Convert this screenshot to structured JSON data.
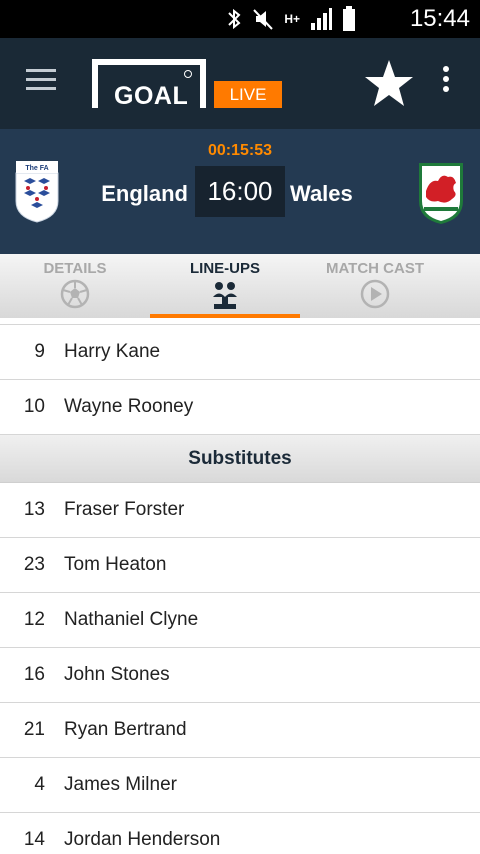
{
  "status_bar": {
    "time": "15:44",
    "network_label": "H+"
  },
  "app_bar": {
    "logo_text": "GOAL",
    "live_label": "LIVE"
  },
  "match": {
    "clock": "00:15:53",
    "home_team": "England",
    "away_team": "Wales",
    "score": "16:00",
    "home_badge_text": "The FA"
  },
  "tabs": [
    {
      "label": "DETAILS",
      "icon": "soccer-ball-icon",
      "active": false
    },
    {
      "label": "LINE-UPS",
      "icon": "lineup-icon",
      "active": true
    },
    {
      "label": "MATCH CAST",
      "icon": "play-circle-icon",
      "active": false
    }
  ],
  "starters_tail": [
    {
      "number": "9",
      "name": "Harry Kane"
    },
    {
      "number": "10",
      "name": "Wayne Rooney"
    }
  ],
  "substitutes_header": "Substitutes",
  "substitutes": [
    {
      "number": "13",
      "name": "Fraser Forster"
    },
    {
      "number": "23",
      "name": "Tom Heaton"
    },
    {
      "number": "12",
      "name": "Nathaniel Clyne"
    },
    {
      "number": "16",
      "name": "John Stones"
    },
    {
      "number": "21",
      "name": "Ryan Bertrand"
    },
    {
      "number": "4",
      "name": "James Milner"
    },
    {
      "number": "14",
      "name": "Jordan Henderson"
    }
  ],
  "colors": {
    "accent": "#ff7a00",
    "app_bar": "#1a2936",
    "match_bar": "#243a52"
  }
}
